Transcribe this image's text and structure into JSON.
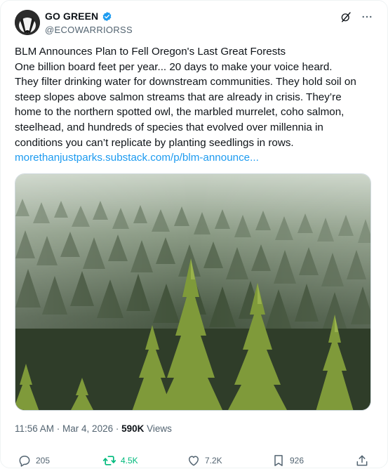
{
  "account": {
    "display_name": "GO GREEN",
    "handle": "@ECOWARRIORSS",
    "verified": true,
    "avatar_icon": "badger-avatar-icon"
  },
  "header_icons": [
    "grok-icon",
    "more-icon"
  ],
  "tweet": {
    "lines": [
      "BLM Announces Plan to Fell Oregon's Last Great Forests",
      "One billion board feet per year... 20 days to make your voice heard.",
      "They filter drinking water for downstream communities. They hold soil on",
      "steep slopes above salmon streams that are already in crisis. They’re",
      "home to the northern spotted owl, the marbled murrelet, coho salmon,",
      "steelhead, and hundreds of species that evolved over millennia in",
      "conditions you can’t replicate by planting seedlings in rows."
    ],
    "link": "morethanjustparks.substack.com/p/blm-announce..."
  },
  "meta": {
    "time": "11:56 AM",
    "sep1": " · ",
    "date": "Mar 4, 2026",
    "sep2": " · ",
    "views_count": "590K",
    "views_label": " Views"
  },
  "actions": {
    "replies": "205",
    "reposts": "4.5K",
    "likes": "7.2K",
    "bookmarks": "926"
  },
  "colors": {
    "link": "#1d9bf0",
    "verified": "#1d9bf0",
    "repost_active": "#00ba7c",
    "secondary_text": "#536471"
  }
}
